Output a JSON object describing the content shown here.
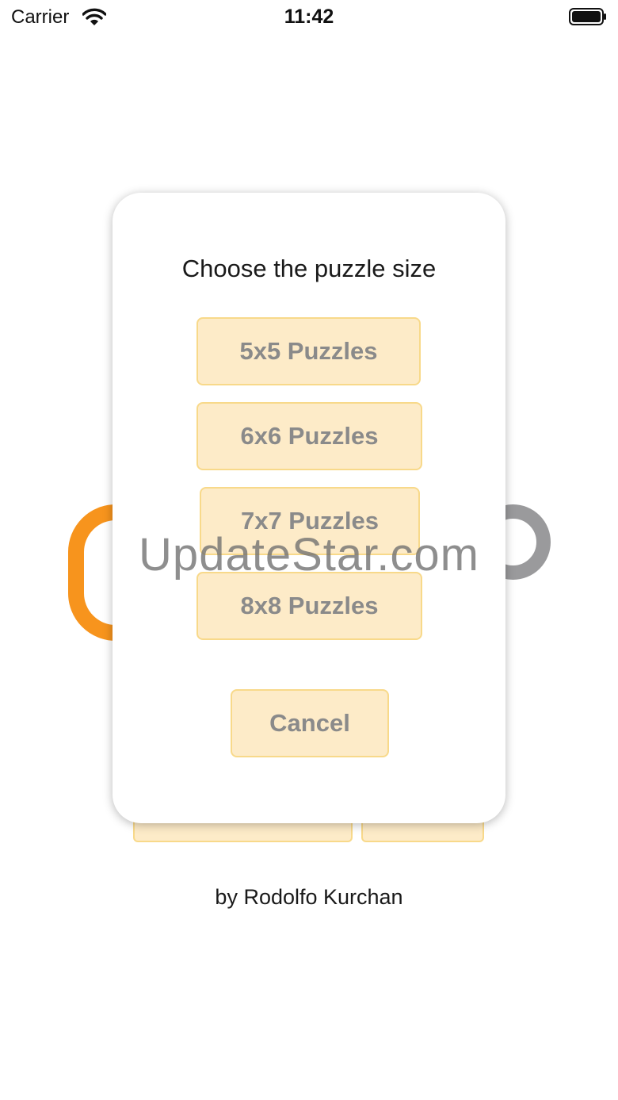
{
  "status_bar": {
    "carrier": "Carrier",
    "time": "11:42",
    "wifi_icon": "wifi-icon",
    "battery_icon": "battery-full-icon"
  },
  "background": {
    "byline": "by Rodolfo Kurchan",
    "colors": {
      "accent_orange": "#f7941d",
      "ring_gray": "#9a9a9c"
    }
  },
  "modal": {
    "title": "Choose the puzzle size",
    "options": [
      {
        "label": "5x5 Puzzles"
      },
      {
        "label": "6x6 Puzzles"
      },
      {
        "label": "7x7 Puzzles"
      },
      {
        "label": "8x8 Puzzles"
      }
    ],
    "cancel_label": "Cancel",
    "colors": {
      "button_fill": "#fdebc8",
      "button_border": "#f8d98a",
      "button_text": "#8a8a8a"
    }
  },
  "watermark": "UpdateStar.com"
}
